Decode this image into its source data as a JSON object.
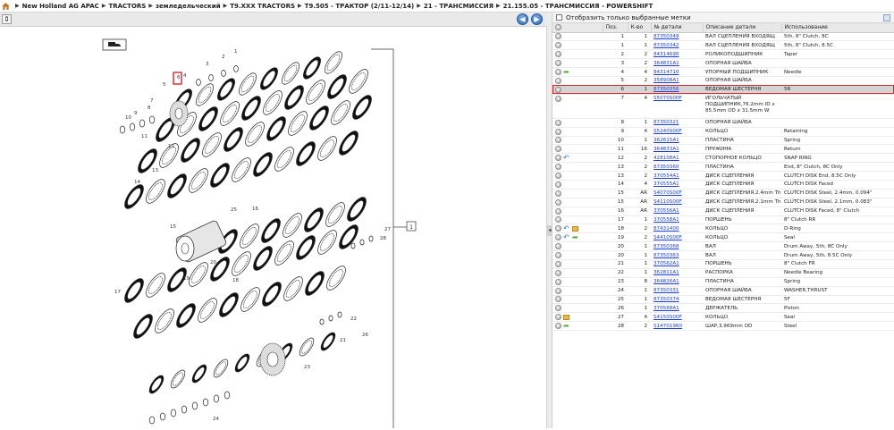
{
  "breadcrumb": [
    "New Holland AG APAC",
    "TRACTORS",
    "земледельческий",
    "T9.XXX TRACTORS",
    "T9.505 - ТРАКТОР (2/11-12/14)",
    "21 - ТРАНСМИССИЯ",
    "21.155.05 - ТРАНСМИССИЯ - POWERSHIFT"
  ],
  "drawing": {
    "callouts": [
      "1",
      "2",
      "3",
      "4",
      "5",
      "6",
      "7",
      "8",
      "9",
      "10",
      "11",
      "12",
      "13",
      "14",
      "15",
      "16",
      "17",
      "18",
      "19",
      "20",
      "21",
      "22",
      "23",
      "24",
      "25",
      "26",
      "27",
      "28"
    ],
    "bracket_label": "1"
  },
  "filter": {
    "label": "Отобразить только выбранные метки"
  },
  "table": {
    "headers": [
      "",
      "Поз.",
      "К-во",
      "№ детали",
      "Описание детали",
      "Использование"
    ],
    "rows": [
      {
        "pos": "1",
        "qty": "1",
        "part": "87350349",
        "desc": "ВАЛ СЦЕПЛЕНИЯ ВХОДЯЩ",
        "use": "5th, 8\" Clutch, 8C",
        "icons": []
      },
      {
        "pos": "1",
        "qty": "1",
        "part": "87350342",
        "desc": "ВАЛ СЦЕПЛЕНИЯ ВХОДЯЩ",
        "use": "5th, 8\" Clutch, 8.5C",
        "icons": []
      },
      {
        "pos": "2",
        "qty": "2",
        "part": "84314690",
        "desc": "РОЛИКОПОДШИПНИК",
        "use": "Taper",
        "icons": []
      },
      {
        "pos": "3",
        "qty": "2",
        "part": "364831A1",
        "desc": "ОПОРНАЯ ШАЙБА",
        "use": "",
        "icons": []
      },
      {
        "pos": "4",
        "qty": "4",
        "part": "84314710",
        "desc": "УПОРНЫЙ ПОДШИПНИК",
        "use": "Needle",
        "icons": [
          "arrow"
        ]
      },
      {
        "pos": "5",
        "qty": "2",
        "part": "358908A1",
        "desc": "ОПОРНАЯ ШАЙБА",
        "use": "",
        "icons": []
      },
      {
        "pos": "6",
        "qty": "1",
        "part": "87350356",
        "desc": "ВЕДОМАЯ ШЕСТЕРНЯ",
        "use": "5R",
        "icons": [],
        "selected": true
      },
      {
        "pos": "7",
        "qty": "4",
        "part": "S5070S00F",
        "desc": "ИГОЛЬЧАТЫЙ ПОДШИПНИК,76.2mm ID x 85.5mm OD x 31.5mm W",
        "use": "",
        "icons": [],
        "tall": true
      },
      {
        "pos": "8",
        "qty": "1",
        "part": "87350321",
        "desc": "ОПОРНАЯ ШАЙБА",
        "use": "",
        "icons": []
      },
      {
        "pos": "9",
        "qty": "4",
        "part": "S5240S00F",
        "desc": "КОЛЬЦО",
        "use": "Retaining",
        "icons": []
      },
      {
        "pos": "10",
        "qty": "1",
        "part": "362615A1",
        "desc": "ПЛАСТИНА",
        "use": "Spring",
        "icons": []
      },
      {
        "pos": "11",
        "qty": "16",
        "part": "364833A1",
        "desc": "ПРУЖИНА",
        "use": "Return",
        "icons": []
      },
      {
        "pos": "12",
        "qty": "2",
        "part": "428108A1",
        "desc": "СТОПОРНОЕ КОЛЬЦО",
        "use": "SNAP RING",
        "icons": [
          "undo"
        ]
      },
      {
        "pos": "13",
        "qty": "2",
        "part": "87350360",
        "desc": "ПЛАСТИНА",
        "use": "End, 8\" Clutch, 8C Only",
        "icons": []
      },
      {
        "pos": "13",
        "qty": "2",
        "part": "370554A1",
        "desc": "ДИСК СЦЕПЛЕНИЯ",
        "use": "CLUTCH DISK End, 8.5C Only",
        "icons": []
      },
      {
        "pos": "14",
        "qty": "4",
        "part": "370555A1",
        "desc": "ДИСК СЦЕПЛЕНИЯ",
        "use": "CLUTCH DISK Faced",
        "icons": []
      },
      {
        "pos": "15",
        "qty": "AR",
        "part": "S4070S00F",
        "desc": "ДИСК СЦЕПЛЕНИЯ,2.4mm Thk",
        "use": "CLUTCH DISK Steel, 2.4mm, 0.094\"",
        "icons": []
      },
      {
        "pos": "15",
        "qty": "AR",
        "part": "S4110S00F",
        "desc": "ДИСК СЦЕПЛЕНИЯ,2.1mm Thk",
        "use": "CLUTCH DISK Steel, 2.1mm, 0.083\"",
        "icons": []
      },
      {
        "pos": "16",
        "qty": "AR",
        "part": "370556A1",
        "desc": "ДИСК СЦЕПЛЕНИЯ",
        "use": "CLUTCH DISK Faced, 8\" Clutch",
        "icons": []
      },
      {
        "pos": "17",
        "qty": "1",
        "part": "370558A1",
        "desc": "ПОРШЕНЬ",
        "use": "8\" Clutch RR",
        "icons": []
      },
      {
        "pos": "18",
        "qty": "2",
        "part": "87431400",
        "desc": "КОЛЬЦО",
        "use": "D-Ring",
        "icons": [
          "undo",
          "box"
        ]
      },
      {
        "pos": "19",
        "qty": "2",
        "part": "S4410S00F",
        "desc": "КОЛЬЦО",
        "use": "Seal",
        "icons": [
          "undo",
          "arrow"
        ]
      },
      {
        "pos": "20",
        "qty": "1",
        "part": "87350368",
        "desc": "ВАЛ",
        "use": "Drum Away, 5th, 8C Only",
        "icons": []
      },
      {
        "pos": "20",
        "qty": "1",
        "part": "87350363",
        "desc": "ВАЛ",
        "use": "Drum Away, 5th, 8.5C Only",
        "icons": []
      },
      {
        "pos": "21",
        "qty": "1",
        "part": "370562A1",
        "desc": "ПОРШЕНЬ",
        "use": "8\" Clutch FR",
        "icons": []
      },
      {
        "pos": "22",
        "qty": "1",
        "part": "362811A1",
        "desc": "РАСПОРКА",
        "use": "Needle Bearing",
        "icons": []
      },
      {
        "pos": "23",
        "qty": "8",
        "part": "364826A1",
        "desc": "ПЛАСТИНА",
        "use": "Spring",
        "icons": []
      },
      {
        "pos": "24",
        "qty": "1",
        "part": "87350331",
        "desc": "ОПОРНАЯ ШАЙБА",
        "use": "WASHER,THRUST",
        "icons": []
      },
      {
        "pos": "25",
        "qty": "1",
        "part": "87350374",
        "desc": "ВЕДОМАЯ ШЕСТЕРНЯ",
        "use": "5F",
        "icons": []
      },
      {
        "pos": "26",
        "qty": "1",
        "part": "370568A1",
        "desc": "ДЕРЖАТЕЛЬ",
        "use": "Piston",
        "icons": []
      },
      {
        "pos": "27",
        "qty": "4",
        "part": "S4150S00F",
        "desc": "КОЛЬЦО",
        "use": "Seal",
        "icons": [
          "box"
        ]
      },
      {
        "pos": "28",
        "qty": "2",
        "part": "S14701960",
        "desc": "ШАР,3.969mm OD",
        "use": "Steel",
        "icons": [
          "arrow"
        ]
      }
    ]
  }
}
